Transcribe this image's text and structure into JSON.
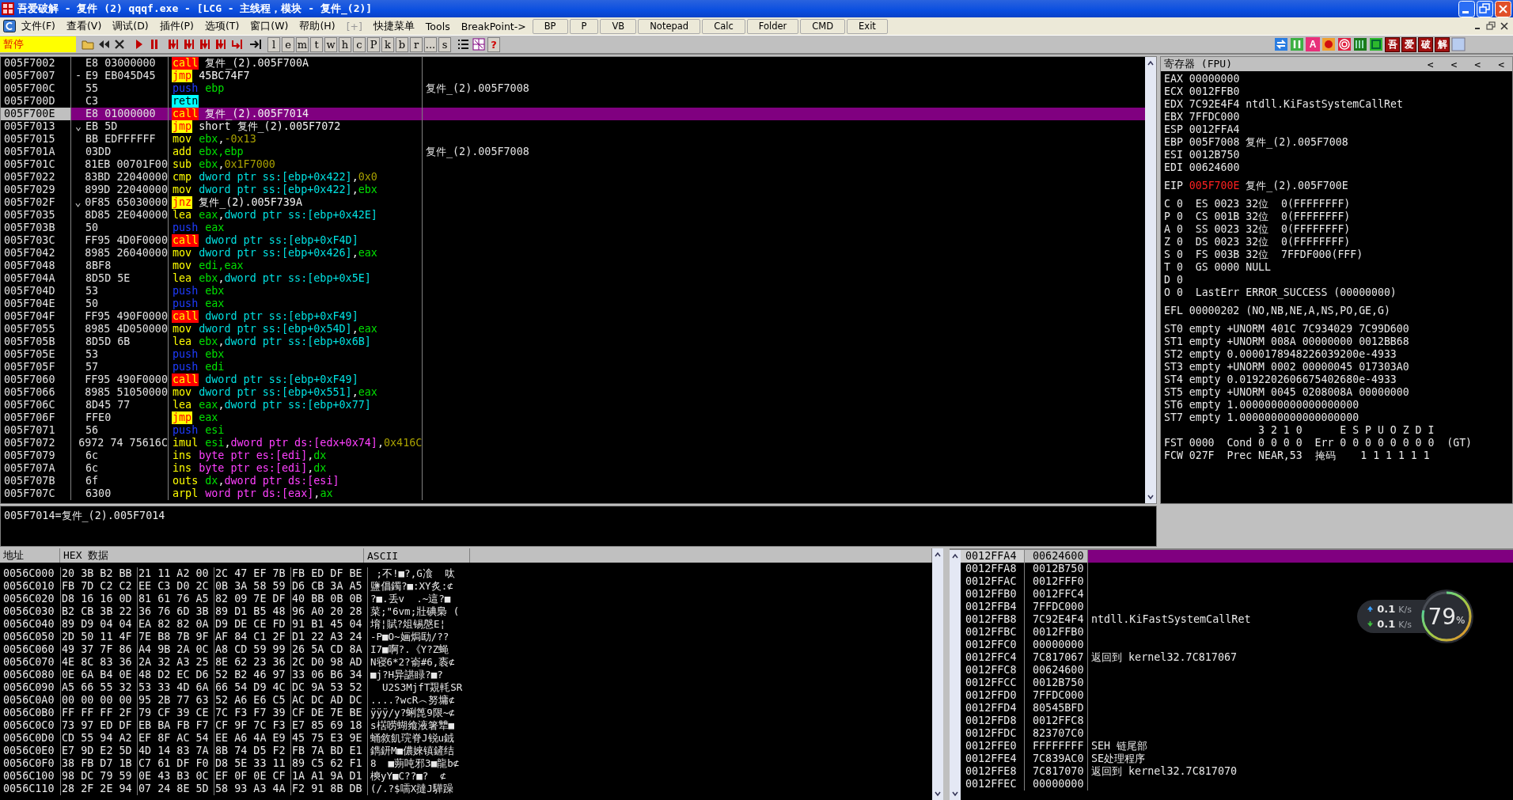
{
  "window": {
    "title": "吾爱破解 - 复件 (2) qqqf.exe - [LCG - 主线程，模块 - 复件_(2)]"
  },
  "menu": [
    {
      "label": "文件(F)",
      "disabled": false
    },
    {
      "label": "查看(V)",
      "disabled": false
    },
    {
      "label": "调试(D)",
      "disabled": false
    },
    {
      "label": "插件(P)",
      "disabled": false
    },
    {
      "label": "选项(T)",
      "disabled": false
    },
    {
      "label": "窗口(W)",
      "disabled": false
    },
    {
      "label": "帮助(H)",
      "disabled": false
    },
    {
      "label": "[+]",
      "disabled": true
    },
    {
      "label": "快捷菜单",
      "disabled": false
    },
    {
      "label": "Tools",
      "disabled": false
    },
    {
      "label": "BreakPoint->",
      "disabled": false
    }
  ],
  "menu_buttons": [
    "BP",
    "P",
    "VB",
    "Notepad",
    "Calc",
    "Folder",
    "CMD",
    "Exit"
  ],
  "toolbar": {
    "status": "暂停",
    "letter_buttons": [
      "l",
      "e",
      "m",
      "t",
      "w",
      "h",
      "c",
      "P",
      "k",
      "b",
      "r",
      "...",
      "s"
    ],
    "help_button": "?",
    "a_button": "A",
    "crack_buttons": [
      "吾",
      "爱",
      "破",
      "解"
    ]
  },
  "disassembly": {
    "rows": [
      {
        "address": "005F7002",
        "hex": "E8 03000000",
        "mnemonic": "call",
        "kind": "call",
        "operands": [
          {
            "text": "复件_(2).005F700A",
            "kind": "label"
          }
        ],
        "selected": false
      },
      {
        "address": "005F7007",
        "marker": "-",
        "hex": "E9 EB045D45",
        "mnemonic": "jmp",
        "kind": "jump",
        "operands": [
          {
            "text": "45BC74F7",
            "kind": "label"
          }
        ],
        "selected": false
      },
      {
        "address": "005F700C",
        "hex": "55",
        "mnemonic": "push",
        "kind": "push",
        "operands": [
          {
            "text": "ebp",
            "kind": "reg"
          }
        ],
        "comment": "复件_(2).005F7008",
        "selected": false
      },
      {
        "address": "005F700D",
        "hex": "C3",
        "mnemonic": "retn",
        "kind": "ret",
        "operands": [],
        "selected": false
      },
      {
        "address": "005F700E",
        "hex": "E8 01000000",
        "mnemonic": "call",
        "kind": "call",
        "operands": [
          {
            "text": "复件_(2).005F7014",
            "kind": "label"
          }
        ],
        "selected": true
      },
      {
        "address": "005F7013",
        "marker": "⌄",
        "hex": "EB 5D",
        "mnemonic": "jmp",
        "kind": "jump",
        "operands": [
          {
            "text": "short 复件_(2).005F7072",
            "kind": "label"
          }
        ],
        "selected": false
      },
      {
        "address": "005F7015",
        "hex": "BB EDFFFFFF",
        "mnemonic": "mov",
        "kind": "plain",
        "operands": [
          {
            "text": "ebx",
            "kind": "reg"
          },
          {
            "text": ",",
            "kind": "punct"
          },
          {
            "text": "-0x13",
            "kind": "imm"
          }
        ],
        "selected": false
      },
      {
        "address": "005F701A",
        "hex": "03DD",
        "mnemonic": "add",
        "kind": "plain",
        "operands": [
          {
            "text": "ebx,ebp",
            "kind": "reg"
          }
        ],
        "comment": "复件_(2).005F7008",
        "selected": false
      },
      {
        "address": "005F701C",
        "hex": "81EB 00701F00",
        "mnemonic": "sub",
        "kind": "plain",
        "operands": [
          {
            "text": "ebx",
            "kind": "reg"
          },
          {
            "text": ",",
            "kind": "punct"
          },
          {
            "text": "0x1F7000",
            "kind": "imm"
          }
        ],
        "selected": false
      },
      {
        "address": "005F7022",
        "hex": "83BD 22040000",
        "mnemonic": "cmp",
        "kind": "plain",
        "operands": [
          {
            "text": "dword ptr ss:[ebp+0x422]",
            "kind": "mem"
          },
          {
            "text": ",",
            "kind": "punct"
          },
          {
            "text": "0x0",
            "kind": "imm"
          }
        ],
        "selected": false
      },
      {
        "address": "005F7029",
        "hex": "899D 22040000",
        "mnemonic": "mov",
        "kind": "plain",
        "operands": [
          {
            "text": "dword ptr ss:[ebp+0x422]",
            "kind": "mem"
          },
          {
            "text": ",",
            "kind": "punct"
          },
          {
            "text": "ebx",
            "kind": "reg"
          }
        ],
        "selected": false
      },
      {
        "address": "005F702F",
        "marker": "⌄",
        "hex": "0F85 65030000",
        "mnemonic": "jnz",
        "kind": "jump",
        "operands": [
          {
            "text": "复件_(2).005F739A",
            "kind": "label"
          }
        ],
        "selected": false
      },
      {
        "address": "005F7035",
        "hex": "8D85 2E040000",
        "mnemonic": "lea",
        "kind": "plain",
        "operands": [
          {
            "text": "eax",
            "kind": "reg"
          },
          {
            "text": ",",
            "kind": "punct"
          },
          {
            "text": "dword ptr ss:[ebp+0x42E]",
            "kind": "mem"
          }
        ],
        "selected": false
      },
      {
        "address": "005F703B",
        "hex": "50",
        "mnemonic": "push",
        "kind": "push",
        "operands": [
          {
            "text": "eax",
            "kind": "reg"
          }
        ],
        "selected": false
      },
      {
        "address": "005F703C",
        "hex": "FF95 4D0F0000",
        "mnemonic": "call",
        "kind": "call",
        "operands": [
          {
            "text": "dword ptr ss:[ebp+0xF4D]",
            "kind": "mem"
          }
        ],
        "selected": false
      },
      {
        "address": "005F7042",
        "hex": "8985 26040000",
        "mnemonic": "mov",
        "kind": "plain",
        "operands": [
          {
            "text": "dword ptr ss:[ebp+0x426]",
            "kind": "mem"
          },
          {
            "text": ",",
            "kind": "punct"
          },
          {
            "text": "eax",
            "kind": "reg"
          }
        ],
        "selected": false
      },
      {
        "address": "005F7048",
        "hex": "8BF8",
        "mnemonic": "mov",
        "kind": "plain",
        "operands": [
          {
            "text": "edi,eax",
            "kind": "reg"
          }
        ],
        "selected": false
      },
      {
        "address": "005F704A",
        "hex": "8D5D 5E",
        "mnemonic": "lea",
        "kind": "plain",
        "operands": [
          {
            "text": "ebx",
            "kind": "reg"
          },
          {
            "text": ",",
            "kind": "punct"
          },
          {
            "text": "dword ptr ss:[ebp+0x5E]",
            "kind": "mem"
          }
        ],
        "selected": false
      },
      {
        "address": "005F704D",
        "hex": "53",
        "mnemonic": "push",
        "kind": "push",
        "operands": [
          {
            "text": "ebx",
            "kind": "reg"
          }
        ],
        "selected": false
      },
      {
        "address": "005F704E",
        "hex": "50",
        "mnemonic": "push",
        "kind": "push",
        "operands": [
          {
            "text": "eax",
            "kind": "reg"
          }
        ],
        "selected": false
      },
      {
        "address": "005F704F",
        "hex": "FF95 490F0000",
        "mnemonic": "call",
        "kind": "call",
        "operands": [
          {
            "text": "dword ptr ss:[ebp+0xF49]",
            "kind": "mem"
          }
        ],
        "selected": false
      },
      {
        "address": "005F7055",
        "hex": "8985 4D050000",
        "mnemonic": "mov",
        "kind": "plain",
        "operands": [
          {
            "text": "dword ptr ss:[ebp+0x54D]",
            "kind": "mem"
          },
          {
            "text": ",",
            "kind": "punct"
          },
          {
            "text": "eax",
            "kind": "reg"
          }
        ],
        "selected": false
      },
      {
        "address": "005F705B",
        "hex": "8D5D 6B",
        "mnemonic": "lea",
        "kind": "plain",
        "operands": [
          {
            "text": "ebx",
            "kind": "reg"
          },
          {
            "text": ",",
            "kind": "punct"
          },
          {
            "text": "dword ptr ss:[ebp+0x6B]",
            "kind": "mem"
          }
        ],
        "selected": false
      },
      {
        "address": "005F705E",
        "hex": "53",
        "mnemonic": "push",
        "kind": "push",
        "operands": [
          {
            "text": "ebx",
            "kind": "reg"
          }
        ],
        "selected": false
      },
      {
        "address": "005F705F",
        "hex": "57",
        "mnemonic": "push",
        "kind": "push",
        "operands": [
          {
            "text": "edi",
            "kind": "reg"
          }
        ],
        "selected": false
      },
      {
        "address": "005F7060",
        "hex": "FF95 490F0000",
        "mnemonic": "call",
        "kind": "call",
        "operands": [
          {
            "text": "dword ptr ss:[ebp+0xF49]",
            "kind": "mem"
          }
        ],
        "selected": false
      },
      {
        "address": "005F7066",
        "hex": "8985 51050000",
        "mnemonic": "mov",
        "kind": "plain",
        "operands": [
          {
            "text": "dword ptr ss:[ebp+0x551]",
            "kind": "mem"
          },
          {
            "text": ",",
            "kind": "punct"
          },
          {
            "text": "eax",
            "kind": "reg"
          }
        ],
        "selected": false
      },
      {
        "address": "005F706C",
        "hex": "8D45 77",
        "mnemonic": "lea",
        "kind": "plain",
        "operands": [
          {
            "text": "eax",
            "kind": "reg"
          },
          {
            "text": ",",
            "kind": "punct"
          },
          {
            "text": "dword ptr ss:[ebp+0x77]",
            "kind": "mem"
          }
        ],
        "selected": false
      },
      {
        "address": "005F706F",
        "hex": "FFE0",
        "mnemonic": "jmp",
        "kind": "jump",
        "operands": [
          {
            "text": "eax",
            "kind": "reg"
          }
        ],
        "selected": false
      },
      {
        "address": "005F7071",
        "hex": "56",
        "mnemonic": "push",
        "kind": "push",
        "operands": [
          {
            "text": "esi",
            "kind": "reg"
          }
        ],
        "selected": false
      },
      {
        "address": "005F7072",
        "hex": "6972 74 75616C",
        "mnemonic": "imul",
        "kind": "plain",
        "operands": [
          {
            "text": "esi",
            "kind": "reg"
          },
          {
            "text": ",",
            "kind": "punct"
          },
          {
            "text": "dword ptr ds:[edx+0x74]",
            "kind": "seg"
          },
          {
            "text": ",",
            "kind": "punct"
          },
          {
            "text": "0x416C",
            "kind": "imm"
          }
        ],
        "selected": false
      },
      {
        "address": "005F7079",
        "hex": "6c",
        "mnemonic": "ins",
        "kind": "plain",
        "operands": [
          {
            "text": "byte ptr es:[edi]",
            "kind": "seg"
          },
          {
            "text": ",",
            "kind": "punct"
          },
          {
            "text": "dx",
            "kind": "reg"
          }
        ],
        "selected": false
      },
      {
        "address": "005F707A",
        "hex": "6c",
        "mnemonic": "ins",
        "kind": "plain",
        "operands": [
          {
            "text": "byte ptr es:[edi]",
            "kind": "seg"
          },
          {
            "text": ",",
            "kind": "punct"
          },
          {
            "text": "dx",
            "kind": "reg"
          }
        ],
        "selected": false
      },
      {
        "address": "005F707B",
        "hex": "6f",
        "mnemonic": "outs",
        "kind": "plain",
        "operands": [
          {
            "text": "dx",
            "kind": "reg"
          },
          {
            "text": ",",
            "kind": "punct"
          },
          {
            "text": "dword ptr ds:[esi]",
            "kind": "seg"
          }
        ],
        "selected": false
      },
      {
        "address": "005F707C",
        "hex": "6300",
        "mnemonic": "arpl",
        "kind": "plain",
        "operands": [
          {
            "text": "word ptr ds:[eax]",
            "kind": "seg"
          },
          {
            "text": ",",
            "kind": "punct"
          },
          {
            "text": "ax",
            "kind": "reg"
          }
        ],
        "selected": false
      }
    ],
    "info_line": "005F7014=复件_(2).005F7014"
  },
  "registers": {
    "title": "寄存器 (FPU)",
    "header_buttons": [
      "<",
      "<",
      "<",
      "<"
    ],
    "general": [
      {
        "name": "EAX",
        "value": "00000000",
        "changed": false
      },
      {
        "name": "ECX",
        "value": "0012FFB0",
        "changed": false
      },
      {
        "name": "EDX",
        "value": "7C92E4F4",
        "comment": "ntdll.KiFastSystemCallRet",
        "changed": false
      },
      {
        "name": "EBX",
        "value": "7FFDC000",
        "changed": false
      },
      {
        "name": "ESP",
        "value": "0012FFA4",
        "changed": false
      },
      {
        "name": "EBP",
        "value": "005F7008",
        "comment": "复件_(2).005F7008",
        "changed": false
      },
      {
        "name": "ESI",
        "value": "0012B750",
        "changed": false
      },
      {
        "name": "EDI",
        "value": "00624600",
        "changed": false
      }
    ],
    "eip": {
      "name": "EIP",
      "value": "005F700E",
      "comment": "复件_(2).005F700E",
      "changed": true
    },
    "flag_lines": [
      "C 0  ES 0023 32位  0(FFFFFFFF)",
      "P 0  CS 001B 32位  0(FFFFFFFF)",
      "A 0  SS 0023 32位  0(FFFFFFFF)",
      "Z 0  DS 0023 32位  0(FFFFFFFF)",
      "S 0  FS 003B 32位  7FFDF000(FFF)",
      "T 0  GS 0000 NULL",
      "D 0",
      "O 0  LastErr ERROR_SUCCESS (00000000)"
    ],
    "efl": "EFL 00000202 (NO,NB,NE,A,NS,PO,GE,G)",
    "fpu_lines": [
      "ST0 empty +UNORM 401C 7C934029 7C99D600",
      "ST1 empty +UNORM 008A 00000000 0012BB68",
      "ST2 empty 0.0000178948226039200e-4933",
      "ST3 empty +UNORM 0002 00000045 017303A0",
      "ST4 empty 0.0192202606675402680e-4933",
      "ST5 empty +UNORM 0045 0208008A 00000000",
      "ST6 empty 1.0000000000000000000",
      "ST7 empty 1.0000000000000000000"
    ],
    "fpu_bit_header": "3 2 1 0      E S P U O Z D I",
    "fpu_status_lines": [
      "FST 0000  Cond 0 0 0 0  Err 0 0 0 0 0 0 0 0  (GT)",
      "FCW 027F  Prec NEAR,53  掩码    1 1 1 1 1 1"
    ]
  },
  "dump": {
    "columns": [
      "地址",
      "HEX 数据",
      "ASCII"
    ],
    "rows": [
      {
        "address": "0056C000",
        "hex": [
          "20 3B B2 BB",
          "21 11 A2 00",
          "2C 47 EF 7B",
          "FB ED DF BE"
        ],
        "ascii": " ;不!■?,G飡  呔"
      },
      {
        "address": "0056C010",
        "hex": [
          "FB 7D C2 C2",
          "EE C3 D0 2C",
          "0B 3A 58 59",
          "D6 CB 3A A5"
        ],
        "ascii": "鹽倡鐲?■:XY炙:⊄"
      },
      {
        "address": "0056C020",
        "hex": [
          "D8 16 16 0D",
          "81 61 76 A5",
          "82 09 7E DF",
          "40 BB 0B 0B"
        ],
        "ascii": "?■.丢v  .~這?■"
      },
      {
        "address": "0056C030",
        "hex": [
          "B2 CB 3B 22",
          "36 76 6D 3B",
          "89 D1 B5 48",
          "96 A0 20 28"
        ],
        "ascii": "菜;\"6vm;壯碘梟 ("
      },
      {
        "address": "0056C040",
        "hex": [
          "89 D9 04 04",
          "EA 82 82 0A",
          "D9 DE CE FD",
          "91 B1 45 04"
        ],
        "ascii": "堉¦賦?俎锡慇E¦"
      },
      {
        "address": "0056C050",
        "hex": [
          "2D 50 11 4F",
          "7E B8 7B 9F",
          "AF 84 C1 2F",
          "D1 22 A3 24"
        ],
        "ascii": "-P■O~婳焗劻/??"
      },
      {
        "address": "0056C060",
        "hex": [
          "49 37 7F 86",
          "A4 9B 2A 0C",
          "A8 CD 59 99",
          "26 5A CD 8A"
        ],
        "ascii": "I7■啊?.《Y?Z蝇"
      },
      {
        "address": "0056C070",
        "hex": [
          "4E 8C 83 36",
          "2A 32 A3 25",
          "8E 62 23 36",
          "2C D0 98 AD"
        ],
        "ascii": "N寝6*2?嵛#6,袠⊄"
      },
      {
        "address": "0056C080",
        "hex": [
          "0E 6A B4 0E",
          "48 D2 EC D6",
          "52 B2 46 97",
          "33 06 B6 34"
        ],
        "ascii": "■j?H异諶睩?■?"
      },
      {
        "address": "0056C090",
        "hex": [
          "A5 66 55 32",
          "53 33 4D 6A",
          "66 54 D9 4C",
          "DC 9A 53 52"
        ],
        "ascii": "  U2S3MjfT覝軞SR"
      },
      {
        "address": "0056C0A0",
        "hex": [
          "00 00 00 00",
          "95 2B 77 63",
          "52 A6 E6 C5",
          "AC DC AD DC"
        ],
        "ascii": "....?wcR︵努墉⊄"
      },
      {
        "address": "0056C0B0",
        "hex": [
          "FF FF FF 2F",
          "79 CF 39 CE",
          "7C F3 F7 39",
          "CF DE 7E BE"
        ],
        "ascii": "ÿÿÿ/y?蜊箆9限~⊄"
      },
      {
        "address": "0056C0C0",
        "hex": [
          "73 97 ED DF",
          "EB BA FB F7",
          "CF 9F 7C F3",
          "E7 85 69 18"
        ],
        "ascii": "s楛唠蝴飨液箸犨■"
      },
      {
        "address": "0056C0D0",
        "hex": [
          "CD 55 94 A2",
          "EF 8F AC 54",
          "EE A6 4A E9",
          "45 75 E3 9E"
        ],
        "ascii": "蛹敘飢琓脊J锐u銊"
      },
      {
        "address": "0056C0E0",
        "hex": [
          "E7 9D E2 5D",
          "4D 14 83 7A",
          "8B 74 D5 F2",
          "FB 7A BD E1"
        ],
        "ascii": "鐫鈃M■儂婡镇鏟结"
      },
      {
        "address": "0056C0F0",
        "hex": [
          "38 FB D7 1B",
          "C7 61 DF F0",
          "D8 5E 33 11",
          "89 C5 62 F1"
        ],
        "ascii": "8  ■蒴吨邪3■龍b⊄"
      },
      {
        "address": "0056C100",
        "hex": [
          "98 DC 79 59",
          "0E 43 B3 0C",
          "EF 0F 0E CF",
          "1A A1 9A D1"
        ],
        "ascii": "樉yY■C??■?  ⊄"
      },
      {
        "address": "0056C110",
        "hex": [
          "28 2F 2E 94",
          "07 24 8E 5D",
          "58 93 A3 4A",
          "F2 91 8B DB"
        ],
        "ascii": "(/.?$嚅X撻J驊躁"
      }
    ]
  },
  "stack": {
    "rows": [
      {
        "address": "0012FFA4",
        "value": "00624600",
        "selected": true
      },
      {
        "address": "0012FFA8",
        "value": "0012B750",
        "selected": false
      },
      {
        "address": "0012FFAC",
        "value": "0012FFF0",
        "selected": false
      },
      {
        "address": "0012FFB0",
        "value": "0012FFC4",
        "selected": false
      },
      {
        "address": "0012FFB4",
        "value": "7FFDC000",
        "selected": false
      },
      {
        "address": "0012FFB8",
        "value": "7C92E4F4",
        "comment": "ntdll.KiFastSystemCallRet",
        "selected": false
      },
      {
        "address": "0012FFBC",
        "value": "0012FFB0",
        "selected": false
      },
      {
        "address": "0012FFC0",
        "value": "00000000",
        "selected": false
      },
      {
        "address": "0012FFC4",
        "value": "7C817067",
        "comment": "返回到 kernel32.7C817067",
        "selected": false
      },
      {
        "address": "0012FFC8",
        "value": "00624600",
        "selected": false
      },
      {
        "address": "0012FFCC",
        "value": "0012B750",
        "selected": false
      },
      {
        "address": "0012FFD0",
        "value": "7FFDC000",
        "selected": false
      },
      {
        "address": "0012FFD4",
        "value": "80545BFD",
        "selected": false
      },
      {
        "address": "0012FFD8",
        "value": "0012FFC8",
        "selected": false
      },
      {
        "address": "0012FFDC",
        "value": "823707C0",
        "selected": false
      },
      {
        "address": "0012FFE0",
        "value": "FFFFFFFF",
        "comment": "SEH 链尾部",
        "selected": false
      },
      {
        "address": "0012FFE4",
        "value": "7C839AC0",
        "comment": "SE处理程序",
        "selected": false
      },
      {
        "address": "0012FFE8",
        "value": "7C817070",
        "comment": "返回到 kernel32.7C817070",
        "selected": false
      },
      {
        "address": "0012FFEC",
        "value": "00000000",
        "selected": false
      }
    ]
  },
  "network_widget": {
    "upload": "0.1",
    "upload_unit": "K/s",
    "download": "0.1",
    "download_unit": "K/s",
    "percent": "79",
    "percent_sign": "%"
  }
}
